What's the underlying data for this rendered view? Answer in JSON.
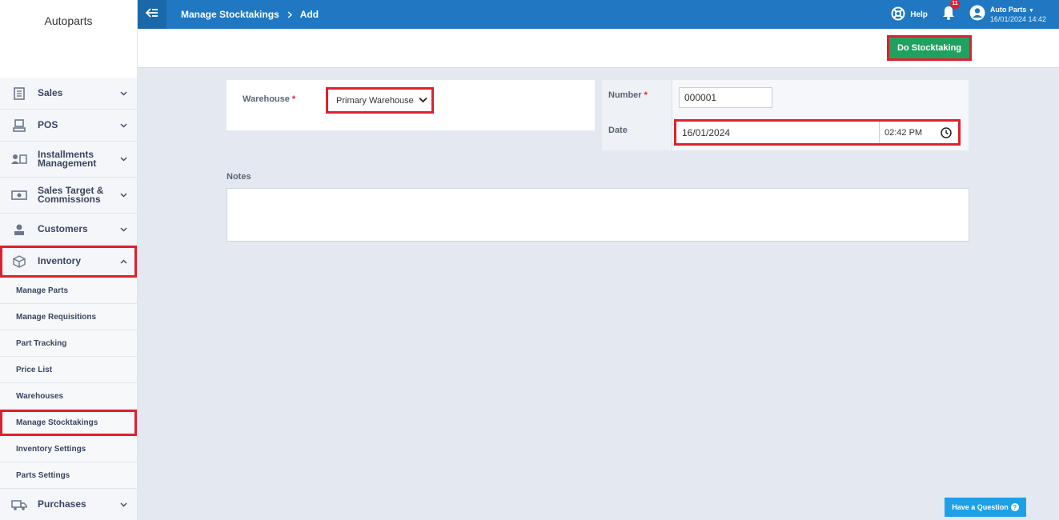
{
  "sidebar": {
    "logo": "Autoparts",
    "items": [
      {
        "label": "Sales"
      },
      {
        "label": "POS"
      },
      {
        "label": "Installments Management"
      },
      {
        "label": "Sales Target & Commissions"
      },
      {
        "label": "Customers"
      },
      {
        "label": "Inventory"
      },
      {
        "label": "Purchases"
      }
    ],
    "inventory_sub": [
      {
        "label": "Manage Parts"
      },
      {
        "label": "Manage Requisitions"
      },
      {
        "label": "Part Tracking"
      },
      {
        "label": "Price List"
      },
      {
        "label": "Warehouses"
      },
      {
        "label": "Manage Stocktakings"
      },
      {
        "label": "Inventory Settings"
      },
      {
        "label": "Parts Settings"
      }
    ]
  },
  "header": {
    "breadcrumb": [
      "Manage Stocktakings",
      "Add"
    ],
    "help": "Help",
    "notifications": "11",
    "user_name": "Auto Parts",
    "user_datetime": "16/01/2024 14:42"
  },
  "actions": {
    "do_stocktaking": "Do Stocktaking"
  },
  "form": {
    "warehouse_label": "Warehouse",
    "required_mark": "*",
    "warehouse_value": "Primary Warehouse",
    "number_label": "Number",
    "number_value": "000001",
    "date_label": "Date",
    "date_value": "16/01/2024",
    "time_value": "02:42 PM",
    "notes_label": "Notes"
  },
  "help_widget": {
    "label": "Have a Question",
    "glyph": "?"
  },
  "colors": {
    "topbar": "#1f78c1",
    "primary_button": "#20a15f",
    "highlight": "#e0202e",
    "help_widget": "#1ea0e6"
  }
}
